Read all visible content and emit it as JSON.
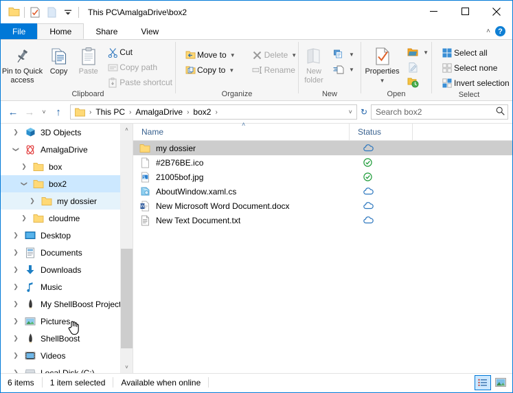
{
  "window": {
    "title": "This PC\\AmalgaDrive\\box2",
    "quick_access": [
      {
        "name": "folder-icon",
        "label": "Folder"
      },
      {
        "name": "properties-icon",
        "label": "Properties"
      },
      {
        "name": "new-folder-icon",
        "label": "New folder"
      },
      {
        "name": "customize-qat-icon",
        "label": "Customize Quick Access Toolbar"
      }
    ],
    "controls": {
      "minimize": "—",
      "maximize": "□",
      "close": "✕"
    }
  },
  "tabs": [
    {
      "label": "File",
      "active": false,
      "style": "file"
    },
    {
      "label": "Home",
      "active": true,
      "style": "normal"
    },
    {
      "label": "Share",
      "active": false,
      "style": "normal"
    },
    {
      "label": "View",
      "active": false,
      "style": "normal"
    }
  ],
  "tabstrip_right": {
    "collapse": "˄",
    "help": "?"
  },
  "ribbon": {
    "groups": [
      {
        "label": "Clipboard",
        "big": [
          {
            "label": "Pin to Quick\naccess",
            "label_line1": "Pin to Quick",
            "label_line2": "access",
            "disabled": false,
            "icon": "pin-icon"
          },
          {
            "label": "Copy",
            "label_line1": "Copy",
            "label_line2": "",
            "disabled": false,
            "icon": "copy-icon"
          },
          {
            "label": "Paste",
            "label_line1": "Paste",
            "label_line2": "",
            "disabled": true,
            "icon": "paste-icon"
          }
        ],
        "small": [
          {
            "label": "Cut",
            "disabled": false,
            "icon": "scissors-icon"
          },
          {
            "label": "Copy path",
            "disabled": true,
            "icon": "copy-path-icon"
          },
          {
            "label": "Paste shortcut",
            "disabled": true,
            "icon": "paste-shortcut-icon"
          }
        ]
      },
      {
        "label": "Organize",
        "small_left": [
          {
            "label": "Move to",
            "disabled": false,
            "dropdown": true,
            "icon": "move-to-icon"
          },
          {
            "label": "Copy to",
            "disabled": false,
            "dropdown": true,
            "icon": "copy-to-icon"
          }
        ],
        "small_right": [
          {
            "label": "Delete",
            "disabled": true,
            "dropdown": true,
            "icon": "delete-icon"
          },
          {
            "label": "Rename",
            "disabled": true,
            "dropdown": false,
            "icon": "rename-icon"
          }
        ]
      },
      {
        "label": "New",
        "big": [
          {
            "label_line1": "New",
            "label_line2": "folder",
            "disabled": true,
            "icon": "new-folder-icon"
          }
        ],
        "small": [
          {
            "label": "",
            "disabled": false,
            "dropdown": true,
            "icon": "new-item-icon"
          },
          {
            "label": "",
            "disabled": false,
            "dropdown": true,
            "icon": "easy-access-icon"
          }
        ]
      },
      {
        "label": "Open",
        "big": [
          {
            "label_line1": "Properties",
            "label_line2": "",
            "disabled": false,
            "icon": "properties-icon",
            "dropdown": true
          }
        ],
        "small": [
          {
            "label": "",
            "disabled": false,
            "dropdown": true,
            "icon": "open-icon"
          },
          {
            "label": "",
            "disabled": true,
            "dropdown": false,
            "icon": "edit-icon"
          },
          {
            "label": "",
            "disabled": false,
            "dropdown": false,
            "icon": "history-icon"
          }
        ]
      },
      {
        "label": "Select",
        "small": [
          {
            "label": "Select all",
            "disabled": false,
            "icon": "select-all-icon"
          },
          {
            "label": "Select none",
            "disabled": false,
            "icon": "select-none-icon"
          },
          {
            "label": "Invert selection",
            "disabled": false,
            "icon": "invert-selection-icon"
          }
        ]
      }
    ]
  },
  "address": {
    "back": "←",
    "forward": "→",
    "recent": "˅",
    "up": "↑",
    "breadcrumbs": [
      "This PC",
      "AmalgaDrive",
      "box2"
    ],
    "separator": "›",
    "dropdown": "˅",
    "refresh": "↻",
    "search_placeholder": "Search box2",
    "search_value": "",
    "search_icon": "⌕"
  },
  "nav_tree": [
    {
      "label": "3D Objects",
      "indent": 1,
      "expander": "collapsed",
      "icon": "3d-objects-icon",
      "state": "none"
    },
    {
      "label": "AmalgaDrive",
      "indent": 1,
      "expander": "expanded",
      "icon": "amalgadrive-icon",
      "state": "none"
    },
    {
      "label": "box",
      "indent": 2,
      "expander": "collapsed",
      "icon": "folder-icon",
      "state": "none"
    },
    {
      "label": "box2",
      "indent": 2,
      "expander": "expanded",
      "icon": "folder-icon",
      "state": "selected"
    },
    {
      "label": "my dossier",
      "indent": 3,
      "expander": "collapsed",
      "icon": "folder-icon",
      "state": "hover"
    },
    {
      "label": "cloudme",
      "indent": 2,
      "expander": "collapsed",
      "icon": "folder-icon",
      "state": "none"
    },
    {
      "label": "Desktop",
      "indent": 1,
      "expander": "collapsed",
      "icon": "desktop-icon",
      "state": "none"
    },
    {
      "label": "Documents",
      "indent": 1,
      "expander": "collapsed",
      "icon": "documents-icon",
      "state": "none"
    },
    {
      "label": "Downloads",
      "indent": 1,
      "expander": "collapsed",
      "icon": "downloads-icon",
      "state": "none"
    },
    {
      "label": "Music",
      "indent": 1,
      "expander": "collapsed",
      "icon": "music-icon",
      "state": "none"
    },
    {
      "label": "My ShellBoost Project",
      "indent": 1,
      "expander": "collapsed",
      "icon": "shellboost-icon",
      "state": "none"
    },
    {
      "label": "Pictures",
      "indent": 1,
      "expander": "collapsed",
      "icon": "pictures-icon",
      "state": "none"
    },
    {
      "label": "ShellBoost",
      "indent": 1,
      "expander": "collapsed",
      "icon": "shellboost-icon",
      "state": "none"
    },
    {
      "label": "Videos",
      "indent": 1,
      "expander": "collapsed",
      "icon": "videos-icon",
      "state": "none"
    },
    {
      "label": "Local Disk (C:)",
      "indent": 1,
      "expander": "collapsed",
      "icon": "local-disk-icon",
      "state": "none"
    }
  ],
  "nav_scrollbar": {
    "up": "˄",
    "down": "˅"
  },
  "file_list": {
    "columns": [
      {
        "label": "Name",
        "sorted": "asc",
        "sort_glyph": "˄"
      },
      {
        "label": "Status",
        "sorted": "none",
        "sort_glyph": ""
      }
    ],
    "rows": [
      {
        "name": "my dossier",
        "icon": "folder-icon",
        "status": "cloud-online-icon",
        "selected": true
      },
      {
        "name": "#2B76BE.ico",
        "icon": "generic-file-icon",
        "status": "check-available-icon",
        "selected": false
      },
      {
        "name": "21005bof.jpg",
        "icon": "image-file-icon",
        "status": "check-available-icon",
        "selected": false
      },
      {
        "name": "AboutWindow.xaml.cs",
        "icon": "csharp-file-icon",
        "status": "cloud-online-icon",
        "selected": false
      },
      {
        "name": "New Microsoft Word Document.docx",
        "icon": "word-file-icon",
        "status": "cloud-online-icon",
        "selected": false
      },
      {
        "name": "New Text Document.txt",
        "icon": "text-file-icon",
        "status": "cloud-online-icon",
        "selected": false
      }
    ]
  },
  "status_bar": {
    "item_count": "6 items",
    "selection": "1 item selected",
    "availability": "Available when online",
    "views": [
      {
        "name": "details-view-button",
        "active": true
      },
      {
        "name": "large-icons-view-button",
        "active": false
      }
    ]
  },
  "colors": {
    "accent": "#0078d7",
    "selection_active": "#cce8ff",
    "selection_hover": "#e5f3fb",
    "selection_inactive": "#cdcdcd",
    "ribbon_bg": "#f6f6f6",
    "folder_yellow": "#ffd76e",
    "cloud_blue": "#2b76be",
    "check_green": "#1f9c3a",
    "header_text": "#38618f"
  }
}
